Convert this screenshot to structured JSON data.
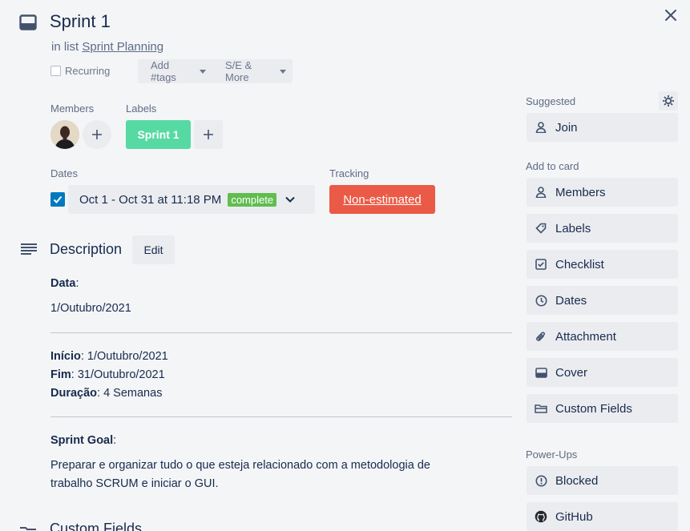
{
  "card": {
    "title": "Sprint 1",
    "in_list_prefix": "in list",
    "list_name": "Sprint Planning"
  },
  "toolbar": {
    "recurring_label": "Recurring",
    "add_tags_label": "Add #tags",
    "se_more_label": "S/E & More"
  },
  "members": {
    "heading": "Members"
  },
  "labels": {
    "heading": "Labels",
    "items": [
      "Sprint 1"
    ],
    "color": "#57d9a3"
  },
  "dates": {
    "heading": "Dates",
    "value": "Oct 1 - Oct 31 at 11:18 PM",
    "badge": "complete",
    "checked": true
  },
  "tracking": {
    "heading": "Tracking",
    "value": "Non-estimated",
    "color": "#eb5a46"
  },
  "description": {
    "heading": "Description",
    "edit_label": "Edit",
    "data_label": "Data",
    "data_value": "1/Outubro/2021",
    "inicio_label": "Início",
    "inicio_value": ": 1/Outubro/2021",
    "fim_label": "Fim",
    "fim_value": ": 31/Outubro/2021",
    "duracao_label": "Duração",
    "duracao_value": ": 4 Semanas",
    "goal_label": "Sprint Goal",
    "goal_line1": "Preparar e organizar tudo o que esteja relacionado com a metodologia de",
    "goal_line2": "trabalho SCRUM e iniciar o GUI."
  },
  "custom_fields_section": {
    "heading": "Custom Fields"
  },
  "sidebar": {
    "suggested_heading": "Suggested",
    "join_label": "Join",
    "add_to_card_heading": "Add to card",
    "add_items": [
      {
        "label": "Members",
        "icon": "person-icon"
      },
      {
        "label": "Labels",
        "icon": "tag-icon"
      },
      {
        "label": "Checklist",
        "icon": "checklist-icon"
      },
      {
        "label": "Dates",
        "icon": "clock-icon"
      },
      {
        "label": "Attachment",
        "icon": "paperclip-icon"
      },
      {
        "label": "Cover",
        "icon": "cover-icon"
      },
      {
        "label": "Custom Fields",
        "icon": "custom-fields-icon"
      }
    ],
    "powerups_heading": "Power-Ups",
    "powerups": [
      {
        "label": "Blocked",
        "icon": "blocked-icon"
      },
      {
        "label": "GitHub",
        "icon": "github-icon"
      }
    ]
  }
}
